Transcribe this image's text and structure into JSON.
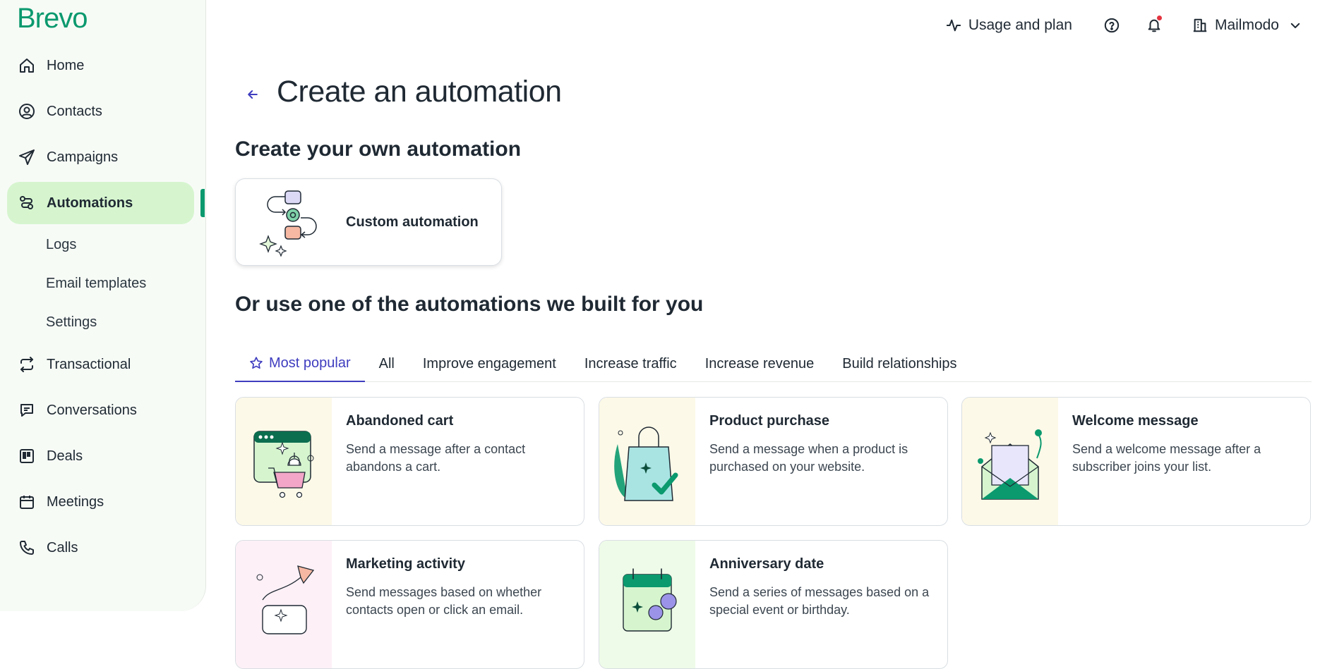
{
  "brand": {
    "logo": "Brevo",
    "accent": "#0b996e",
    "active_bg": "#d6f5cf",
    "tab_accent": "#3f3dbf"
  },
  "sidebar": {
    "items": [
      {
        "label": "Home",
        "icon": "home-icon"
      },
      {
        "label": "Contacts",
        "icon": "contacts-icon"
      },
      {
        "label": "Campaigns",
        "icon": "send-icon"
      },
      {
        "label": "Automations",
        "icon": "automation-icon",
        "active": true
      },
      {
        "label": "Transactional",
        "icon": "transactional-icon"
      },
      {
        "label": "Conversations",
        "icon": "chat-icon"
      },
      {
        "label": "Deals",
        "icon": "deals-icon"
      },
      {
        "label": "Meetings",
        "icon": "calendar-icon"
      },
      {
        "label": "Calls",
        "icon": "phone-icon"
      }
    ],
    "sub_items": [
      "Logs",
      "Email templates",
      "Settings"
    ]
  },
  "topbar": {
    "usage_label": "Usage and plan",
    "account_label": "Mailmodo"
  },
  "main": {
    "title": "Create an automation",
    "own_section_title": "Create your own automation",
    "custom_card_label": "Custom automation",
    "prebuilt_section_title": "Or use one of the automations we built for you",
    "tabs": [
      "Most popular",
      "All",
      "Improve engagement",
      "Increase traffic",
      "Increase revenue",
      "Build relationships"
    ],
    "templates": [
      {
        "title": "Abandoned cart",
        "description": "Send a message after a contact abandons a cart."
      },
      {
        "title": "Product purchase",
        "description": "Send a message when a product is purchased on your website."
      },
      {
        "title": "Welcome message",
        "description": "Send a welcome message after a subscriber joins your list."
      },
      {
        "title": "Marketing activity",
        "description": "Send messages based on whether contacts open or click an email."
      },
      {
        "title": "Anniversary date",
        "description": "Send a series of messages based on a special event or birthday."
      }
    ]
  }
}
